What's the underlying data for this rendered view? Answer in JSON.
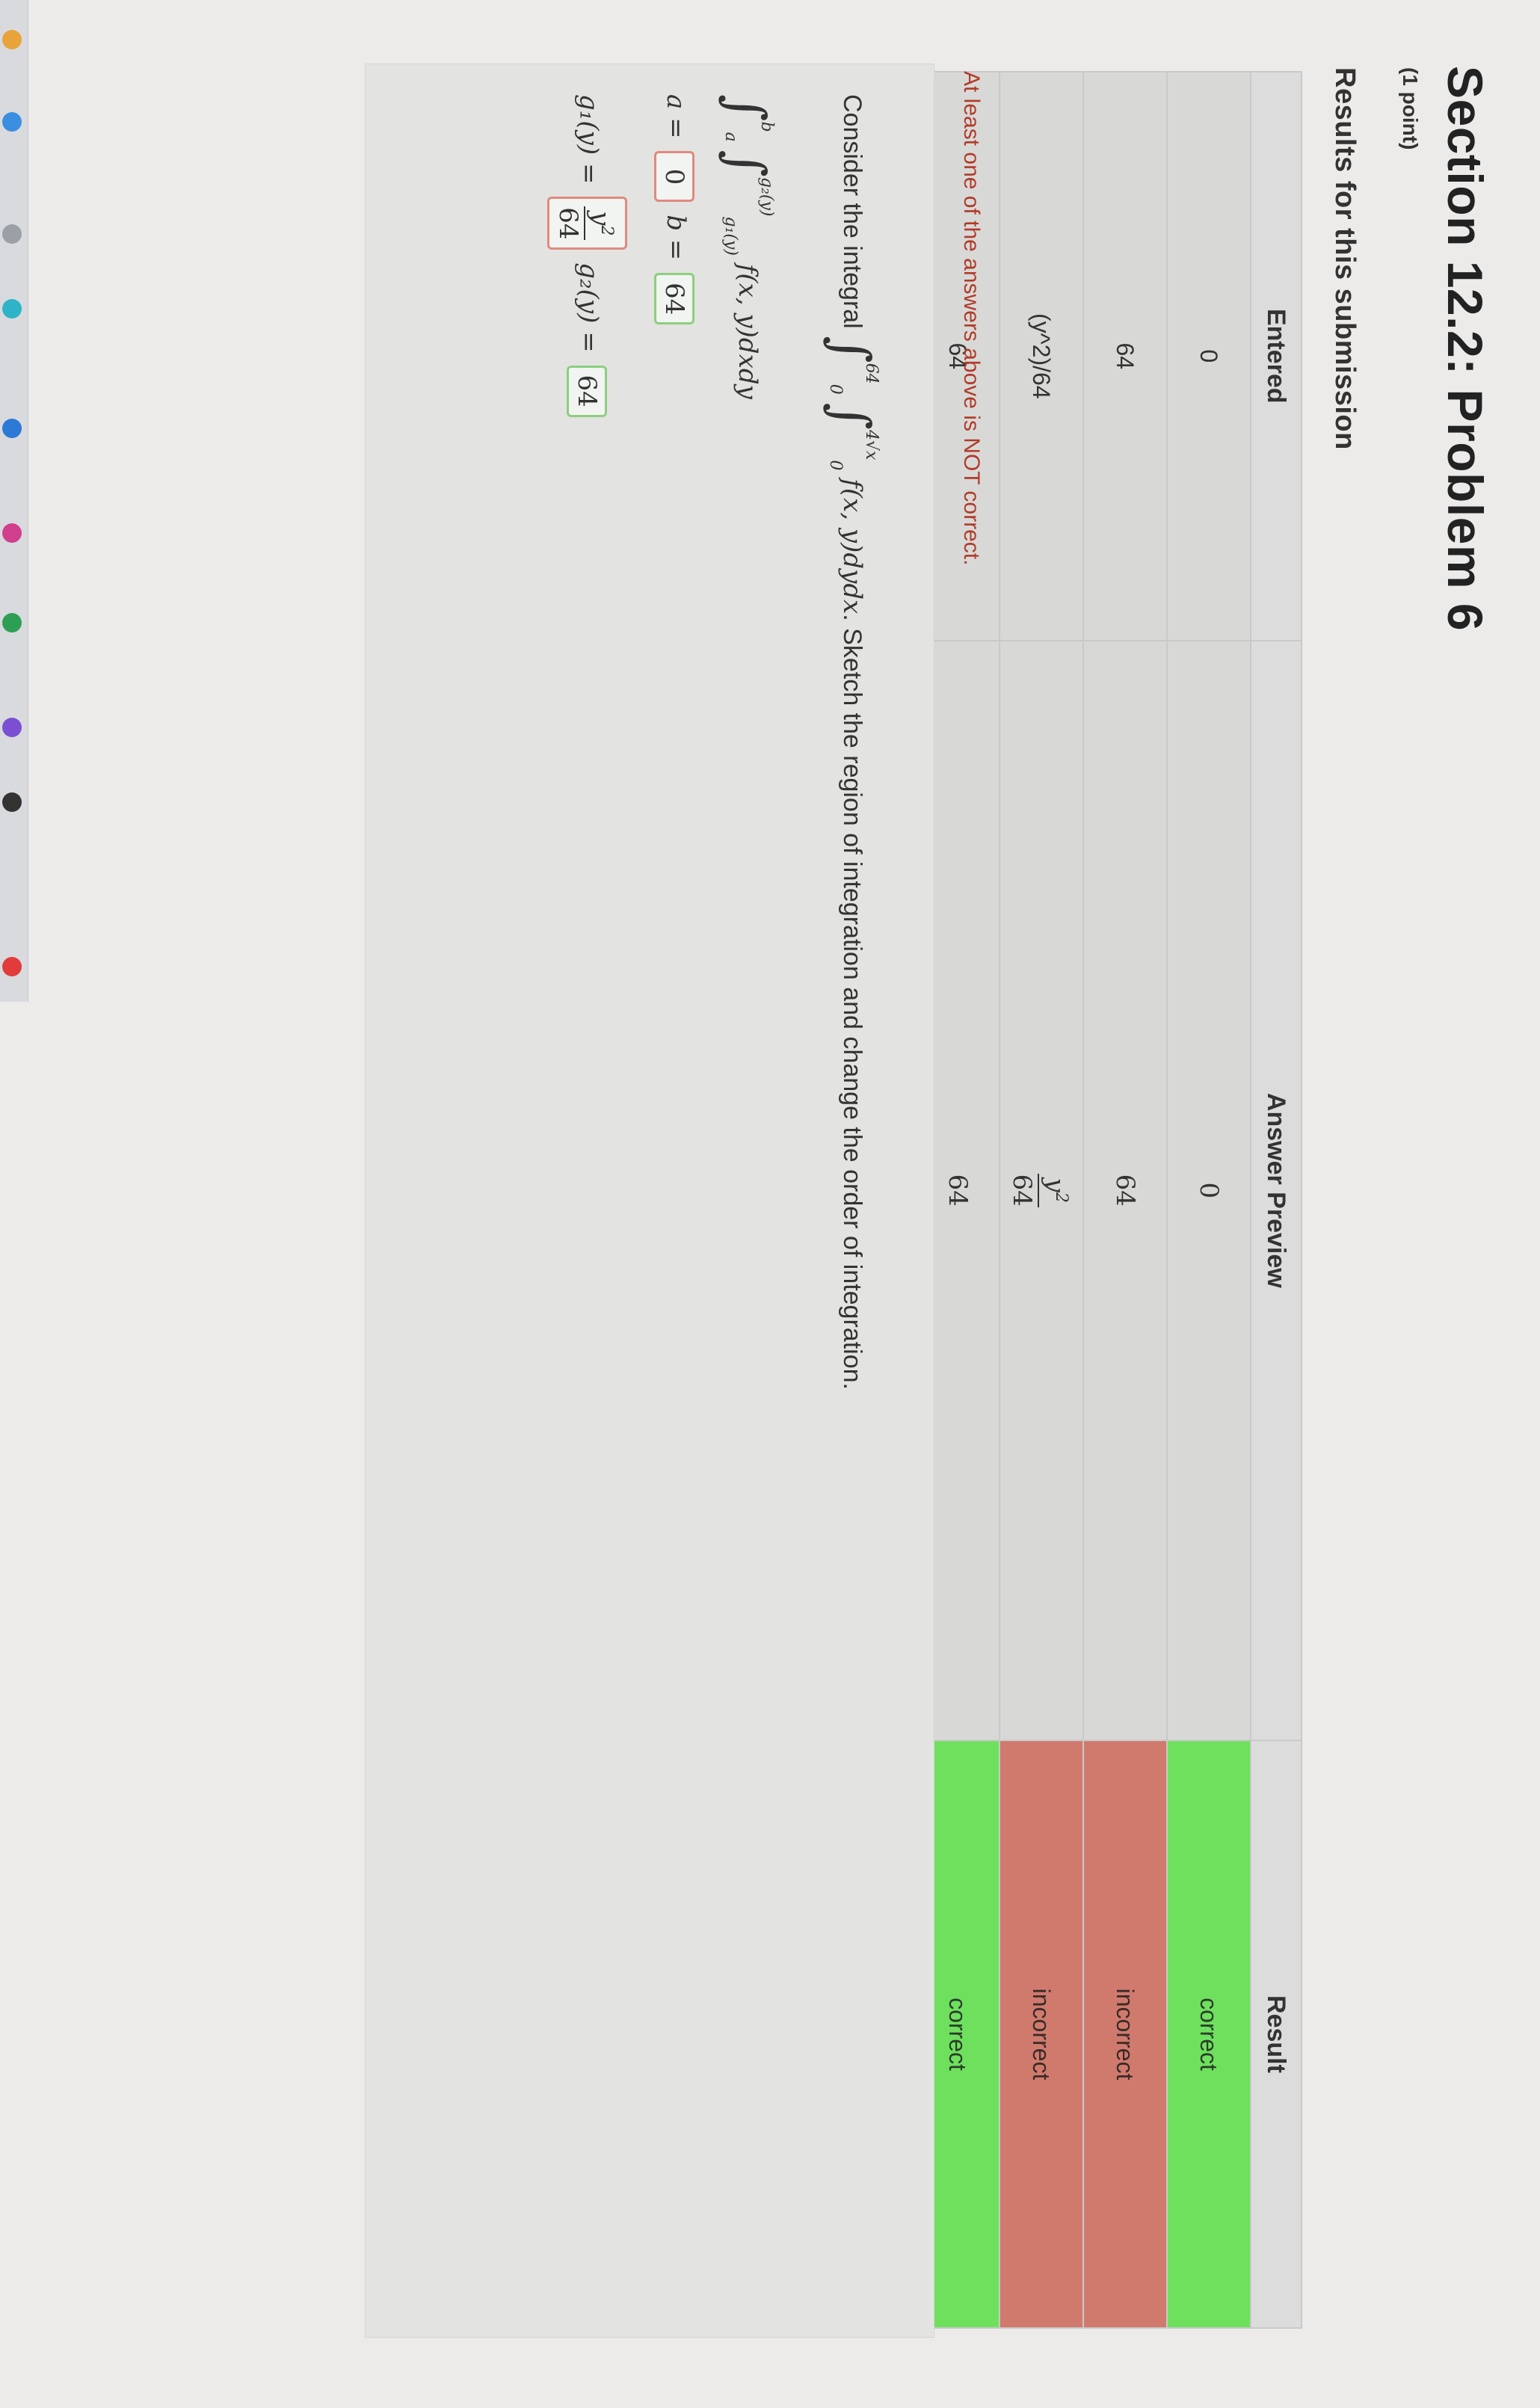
{
  "header": {
    "title": "Section 12.2: Problem 6",
    "points": "(1 point)"
  },
  "results": {
    "heading": "Results for this submission",
    "columns": [
      "Entered",
      "Answer Preview",
      "Result"
    ],
    "rows": [
      {
        "entered": "0",
        "preview": "0",
        "result": "correct",
        "status": "correct"
      },
      {
        "entered": "64",
        "preview": "64",
        "result": "incorrect",
        "status": "incorrect"
      },
      {
        "entered": "(y^2)/64",
        "preview_num": "y",
        "preview_num_sup": "2",
        "preview_den": "64",
        "result": "incorrect",
        "status": "incorrect"
      },
      {
        "entered": "64",
        "preview": "64",
        "result": "correct",
        "status": "correct"
      }
    ],
    "warning": "At least one of the answers above is NOT correct."
  },
  "problem": {
    "intro": "Consider the integral",
    "outer_lower": "0",
    "outer_upper": "64",
    "inner_lower": "0",
    "inner_upper": "4√x",
    "integrand": "f(x, y)dydx",
    "instructions": ". Sketch the region of integration and change the order of integration.",
    "rewritten": {
      "outer_lower": "a",
      "outer_upper": "b",
      "inner_lower": "g₁(y)",
      "inner_upper": "g₂(y)",
      "integrand": "f(x, y)dxdy"
    },
    "a_label": "a =",
    "a_value": "0",
    "b_label": "b =",
    "b_value": "64",
    "g1_label": "g₁(y) =",
    "g1_num": "y",
    "g1_num_sup": "2",
    "g1_den": "64",
    "g2_label": "g₂(y) =",
    "g2_value": "64"
  },
  "colors": {
    "correct": "#6fe05e",
    "incorrect": "#d07a6d",
    "warning_text": "#b23a2a"
  }
}
